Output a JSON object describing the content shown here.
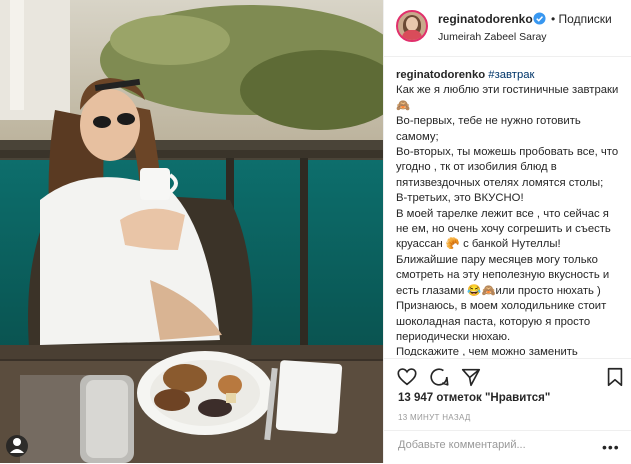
{
  "header": {
    "username": "reginatodorenko",
    "separator": "•",
    "follow_label": "Подписки",
    "location": "Jumeirah Zabeel Saray"
  },
  "caption": {
    "username": "reginatodorenko",
    "hashtag": "#завтрак",
    "lines": [
      "Как же я люблю эти гостиничные завтраки 🙈",
      "Во-первых, тебе не нужно готовить самому;",
      "Во-вторых, ты можешь пробовать все, что угодно , тк от изобилия блюд в пятизвездочных отелях ломятся столы;",
      "В-третьих, это ВКУСНО!",
      "В моей тарелке лежит все , что сейчас я не ем, но очень хочу согрешить и съесть круассан 🥐 с банкой Нутеллы!",
      "Ближайшие пару месяцев могу только смотреть на эту неполезную вкусность и есть глазами 😂🙈или просто нюхать )",
      "Признаюсь, в моем холодильнике стоит шоколадная паста, которую я просто периодически нюхаю.",
      "Подскажите , чем можно заменить шоколад 🍫?"
    ]
  },
  "actions": {
    "like_icon": "heart-icon",
    "comment_icon": "comment-icon",
    "share_icon": "share-icon",
    "save_icon": "bookmark-icon"
  },
  "likes_text": "13 947 отметок \"Нравится\"",
  "timestamp": "13 МИНУТ НАЗАД",
  "comment_box": {
    "placeholder": "Добавьте комментарий...",
    "more": "•••"
  },
  "colors": {
    "verified": "#3897f0",
    "hashtag": "#003569",
    "muted": "#999999",
    "text": "#262626"
  }
}
